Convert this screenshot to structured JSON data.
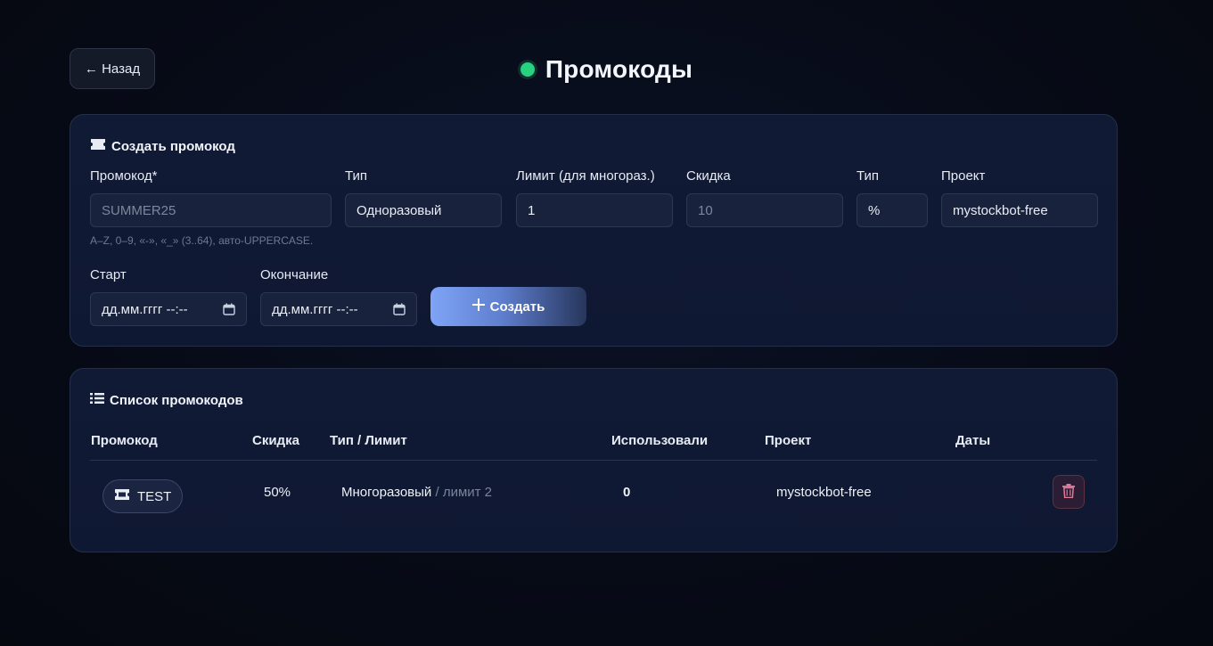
{
  "header": {
    "back_label": "← Назад",
    "title": "Промокоды",
    "status_color": "#27d17f"
  },
  "create": {
    "heading": "Создать промокод",
    "heading_icon": "ticket-icon",
    "fields": {
      "code": {
        "label": "Промокод*",
        "placeholder": "SUMMER25"
      },
      "type": {
        "label": "Тип",
        "value": "Одноразовый"
      },
      "limit": {
        "label": "Лимит (для многораз.)",
        "value": "1"
      },
      "discount": {
        "label": "Скидка",
        "placeholder": "10"
      },
      "discount_type": {
        "label": "Тип",
        "value": "%"
      },
      "project": {
        "label": "Проект",
        "value": "mystockbot-free"
      },
      "start": {
        "label": "Старт",
        "placeholder": "дд.мм.гггг --:--"
      },
      "end": {
        "label": "Окончание",
        "placeholder": "дд.мм.гггг --:--"
      }
    },
    "hint": "A–Z, 0–9, «-», «_» (3..64), авто-UPPERCASE.",
    "submit_label": "Создать"
  },
  "list": {
    "heading": "Список промокодов",
    "heading_icon": "list-icon",
    "columns": [
      "Промокод",
      "Скидка",
      "Тип / Лимит",
      "Использовали",
      "Проект",
      "Даты"
    ],
    "rows": [
      {
        "code": "TEST",
        "discount": "50%",
        "type": "Многоразовый",
        "limit": "/ лимит 2",
        "used": "0",
        "project": "mystockbot-free",
        "dates": ""
      }
    ]
  },
  "colors": {
    "accent": "#7fa4f7",
    "danger": "#e07a98"
  }
}
